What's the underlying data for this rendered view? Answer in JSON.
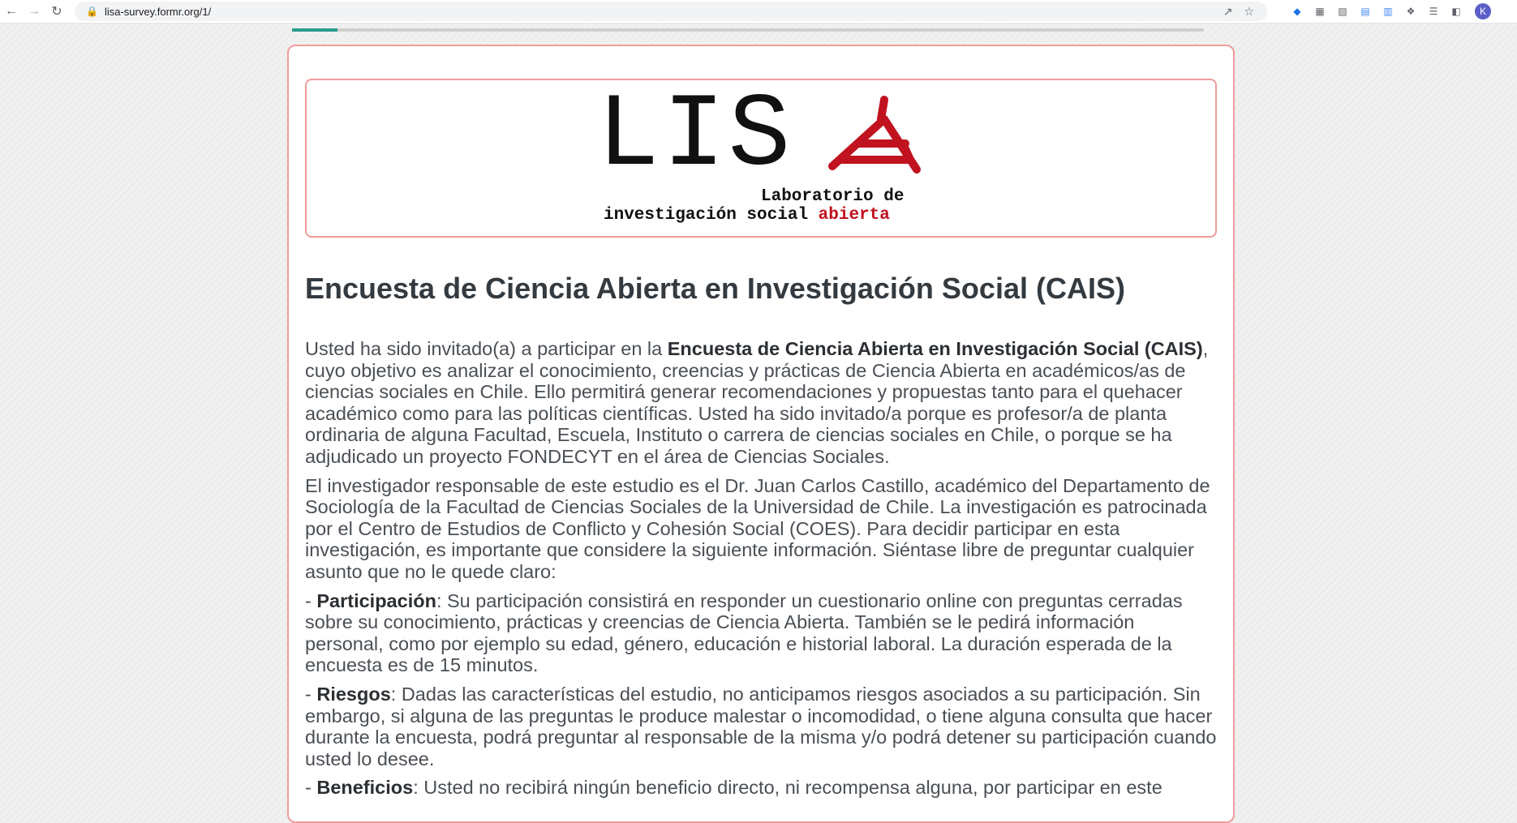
{
  "browser": {
    "url": "lisa-survey.formr.org/1/",
    "avatar_letter": "K"
  },
  "progress": {
    "fraction": 0.05
  },
  "logo": {
    "letters": "LIS",
    "line1": "Laboratorio de",
    "line2_black": "investigación social",
    "line2_red": "abierta",
    "brand_red": "#c1121f"
  },
  "survey": {
    "title": "Encuesta de Ciencia Abierta en Investigación Social (CAIS)",
    "intro_lead": "Usted ha sido invitado(a) a participar en la ",
    "intro_bold": "Encuesta de Ciencia Abierta en Investigación Social (CAIS)",
    "intro_rest": ", cuyo objetivo es analizar el conocimiento, creencias y prácticas de Ciencia Abierta en académicos/as de ciencias sociales en Chile. Ello permitirá generar recomendaciones y propuestas tanto para el quehacer académico como para las políticas científicas. Usted ha sido invitado/a porque es profesor/a de planta ordinaria de alguna Facultad, Escuela, Instituto o carrera de ciencias sociales en Chile, o porque se ha adjudicado un proyecto FONDECYT en el área de Ciencias Sociales.",
    "investigator": "El investigador responsable de este estudio es el Dr. Juan Carlos Castillo, académico del Departamento de Sociología de la Facultad de Ciencias Sociales de la Universidad de Chile. La investigación es patrocinada por el Centro de Estudios de Conflicto y Cohesión Social (COES). Para decidir participar en esta investigación, es importante que considere la siguiente información. Siéntase libre de preguntar cualquier asunto que no le quede claro:",
    "dash": "- ",
    "participation_label": "Participación",
    "participation_text": ": Su participación consistirá en responder un cuestionario online con preguntas cerradas sobre su conocimiento, prácticas y creencias de Ciencia Abierta. También se le pedirá información personal, como por ejemplo su edad, género, educación e historial laboral. La duración esperada de la encuesta es de 15 minutos.",
    "risks_label": "Riesgos",
    "risks_text": ": Dadas las características del estudio, no anticipamos riesgos asociados a su participación. Sin embargo, si alguna de las preguntas le produce malestar o incomodidad, o tiene alguna consulta que hacer durante la encuesta, podrá preguntar al responsable de la misma y/o podrá detener su participación cuando usted lo desee.",
    "benefits_label": "Beneficios",
    "benefits_text": ": Usted no recibirá ningún beneficio directo, ni recompensa alguna, por participar en este"
  }
}
